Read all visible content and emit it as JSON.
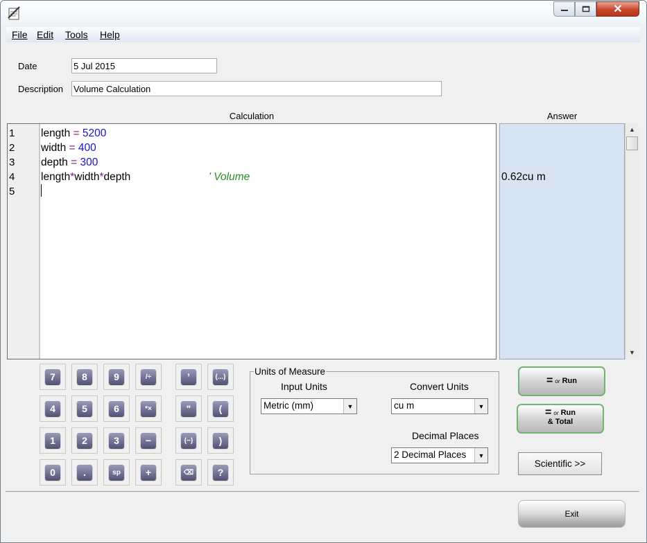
{
  "window": {
    "close_glyph": "✕"
  },
  "menu": [
    "File",
    "Edit",
    "Tools",
    "Help"
  ],
  "form": {
    "date_label": "Date",
    "date_value": "5 Jul 2015",
    "description_label": "Description",
    "description_value": "Volume Calculation"
  },
  "headers": {
    "calculation": "Calculation",
    "answer": "Answer"
  },
  "editor": {
    "line_numbers": [
      "1",
      "2",
      "3",
      "4",
      "5"
    ],
    "lines": [
      {
        "var": "length",
        "eq": " = ",
        "num": "5200"
      },
      {
        "var": "width",
        "eq": " = ",
        "num": "400"
      },
      {
        "var": "depth",
        "eq": " = ",
        "num": "300"
      },
      {
        "a": "length",
        "op1": "*",
        "b": "width",
        "op2": "*",
        "c": "depth",
        "comment": "' Volume"
      }
    ]
  },
  "answers": {
    "line4": "0.62cu m"
  },
  "keypad": {
    "digits": [
      "7",
      "8",
      "9",
      "4",
      "5",
      "6",
      "1",
      "2",
      "3",
      "0",
      ".",
      "sp"
    ],
    "ops": [
      "/÷",
      "*×",
      "−",
      "+"
    ],
    "extra": [
      "’",
      "(...)",
      "\"",
      "(",
      "(−)",
      ")",
      "⌫",
      "?"
    ]
  },
  "units": {
    "group_title": "Units of Measure",
    "input_label": "Input Units",
    "input_value": "Metric (mm)",
    "convert_label": "Convert Units",
    "convert_value": "cu m",
    "decimal_label": "Decimal Places",
    "decimal_value": "2 Decimal Places"
  },
  "buttons": {
    "run_eq": "=",
    "run_or": "or",
    "run_label": "Run",
    "run_total_label": "& Total",
    "scientific": "Scientific >>",
    "exit": "Exit"
  },
  "colors": {
    "answer_bg": "#d9e4f2",
    "run_border": "#6fb56f",
    "close_red": "#c7452b"
  }
}
